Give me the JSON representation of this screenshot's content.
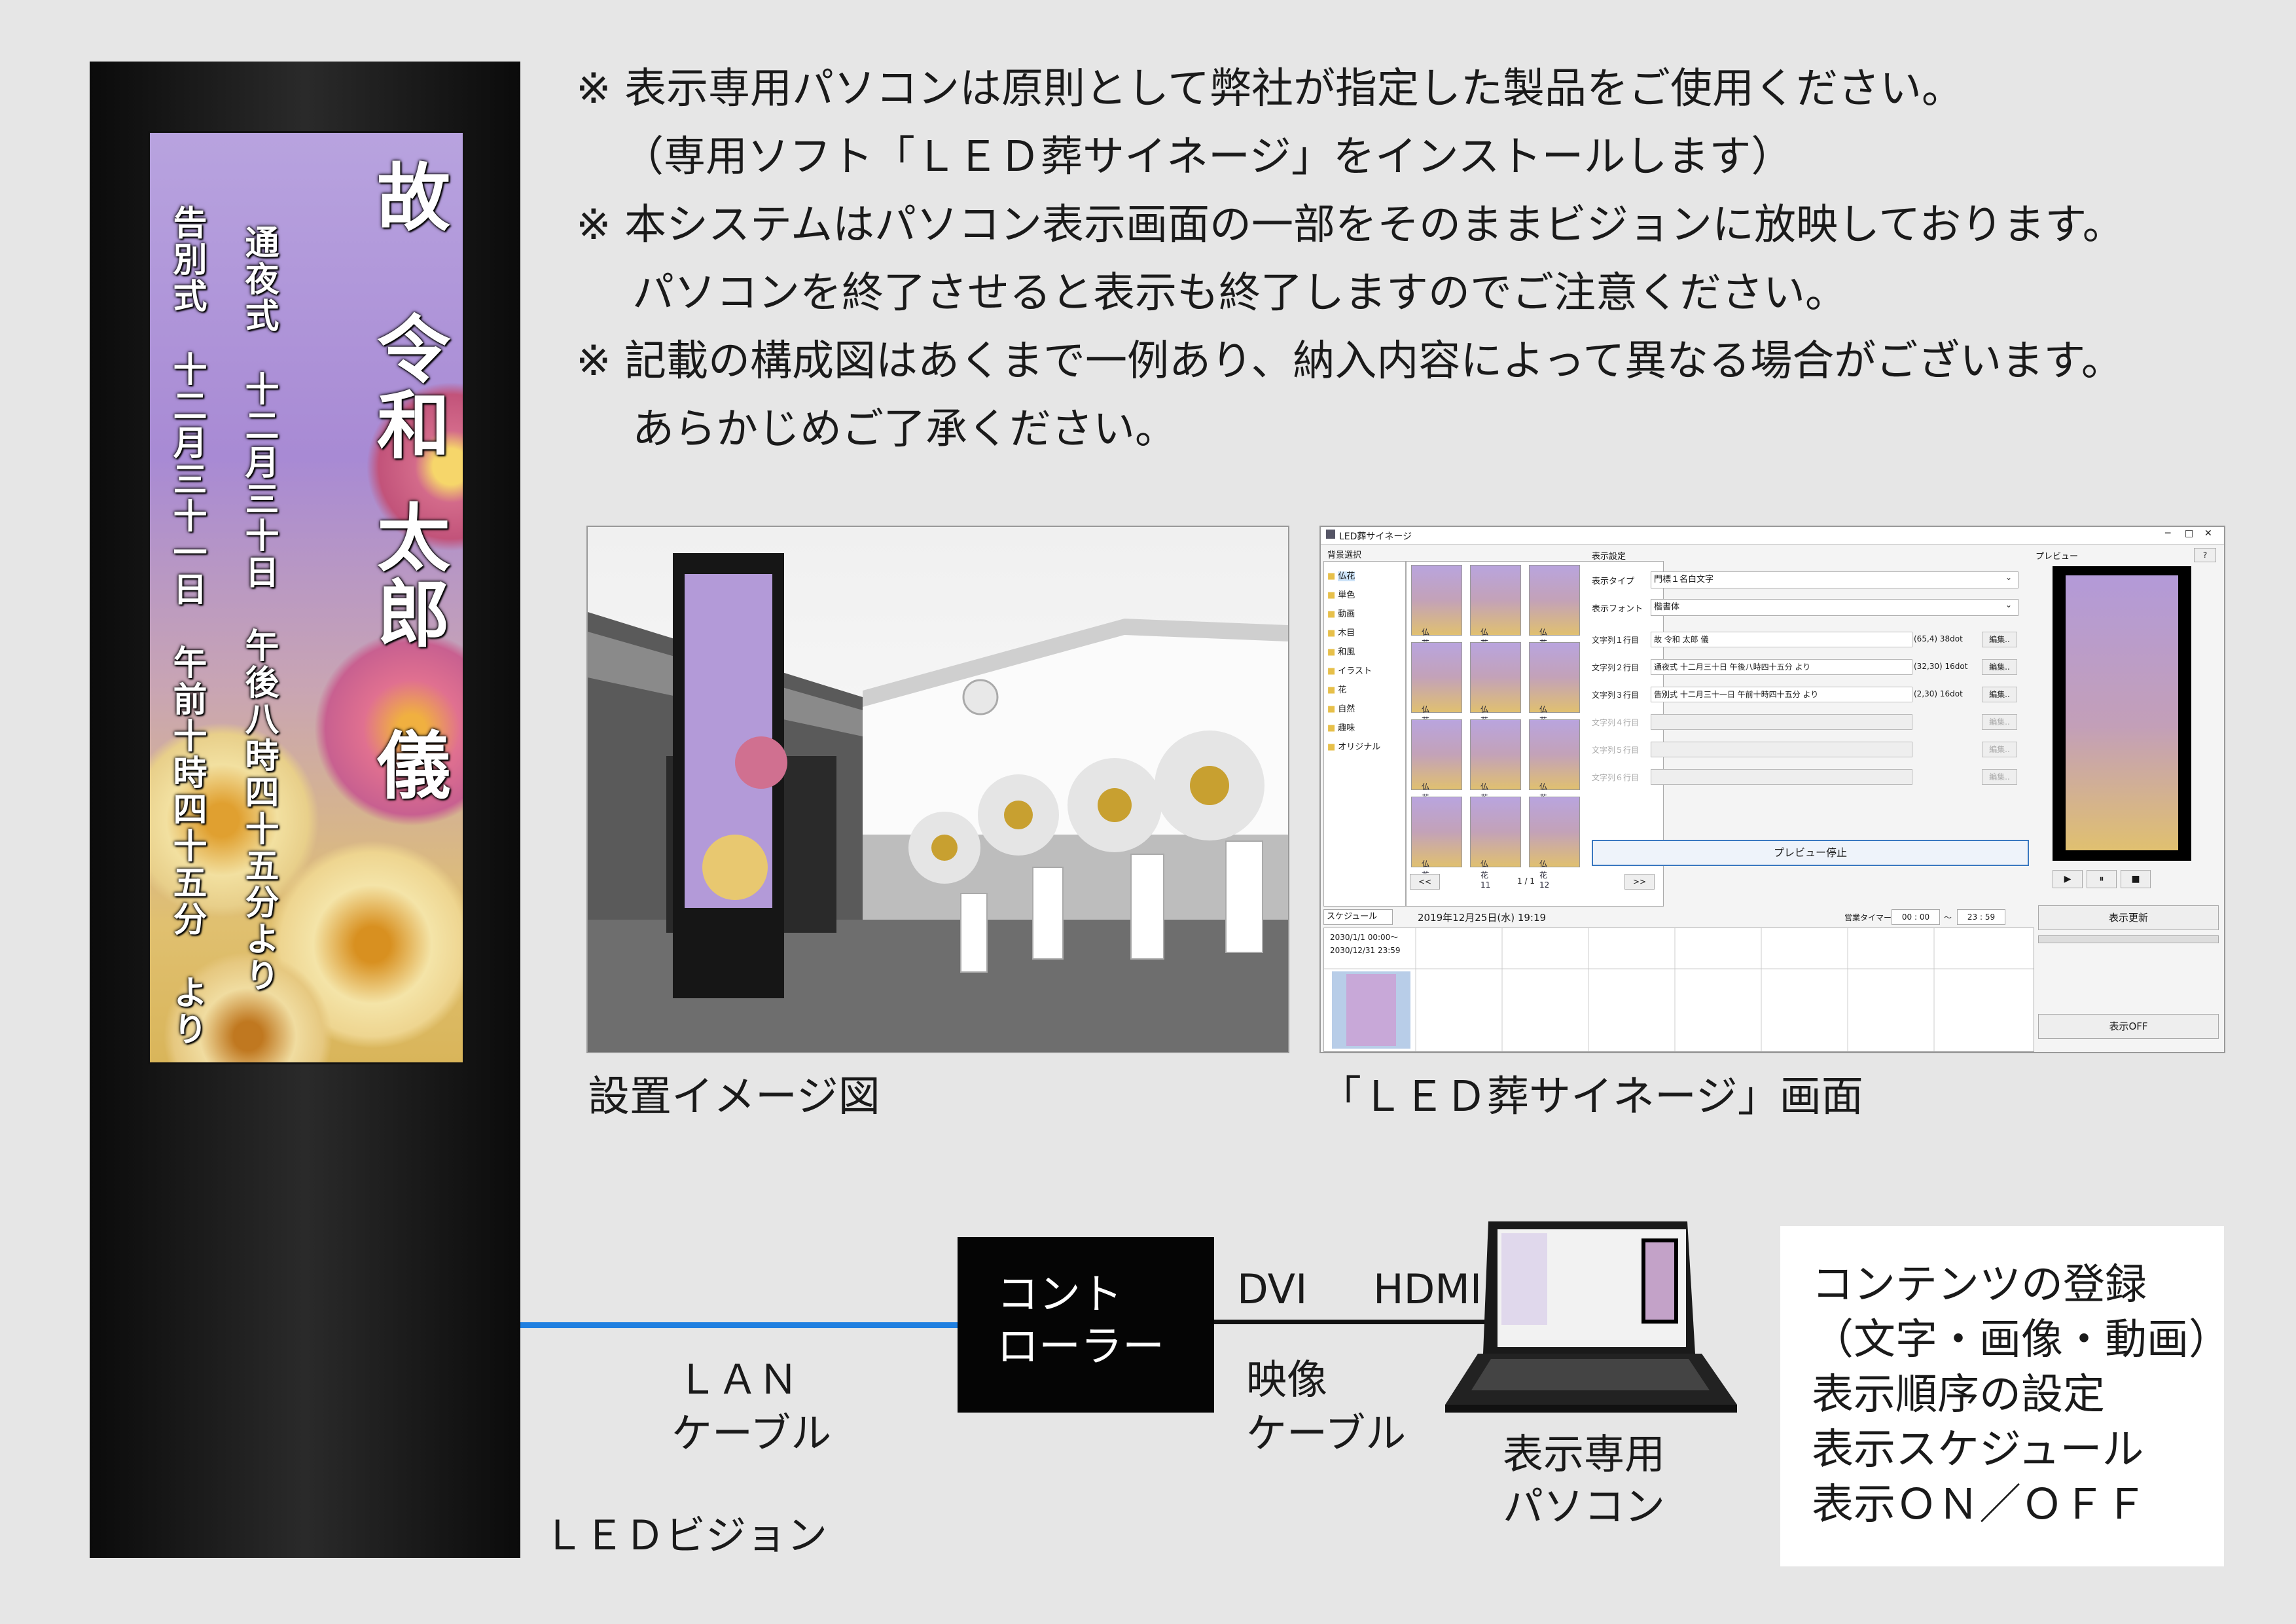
{
  "sign": {
    "main_col1": "故　令和",
    "main_col2": "太郎　儀",
    "line_wake": "通夜式　十二月三十日　午後八時四十五分より",
    "line_funeral": "告別式　十二月三十一日　午前十時四十五分　より"
  },
  "notes": [
    "※ 表示専用パソコンは原則として弊社が指定した製品をご使用ください。",
    "（専用ソフト「ＬＥＤ葬サイネージ」をインストールします）",
    "※ 本システムはパソコン表示画面の一部をそのままビジョンに放映しております。",
    "パソコンを終了させると表示も終了しますのでご注意ください。",
    "※ 記載の構成図はあくまで一例あり、納入内容によって異なる場合がございます。",
    "あらかじめご了承ください。"
  ],
  "captions": {
    "photo": "設置イメージ図",
    "app": "「ＬＥＤ葬サイネージ」画面"
  },
  "app": {
    "title": "LED葬サイネージ",
    "bg_panel_title": "背景選択",
    "categories": [
      "仏花",
      "単色",
      "動画",
      "木目",
      "和風",
      "イラスト",
      "花",
      "自然",
      "趣味",
      "オリジナル"
    ],
    "thumbs": [
      "仏花01",
      "仏花02",
      "仏花03",
      "仏花04",
      "仏花05",
      "仏花06",
      "仏花07",
      "仏花08",
      "仏花09",
      "仏花10",
      "仏花11",
      "仏花12"
    ],
    "pager": {
      "prev": "<<",
      "page": "1 / 1",
      "next": ">>"
    },
    "settings_title": "表示設定",
    "type_label": "表示タイプ",
    "type_value": "門標１名白文字",
    "font_label": "表示フォント",
    "font_value": "楷書体",
    "rows": [
      {
        "label": "文字列１行目",
        "value": "故 令和 太郎 儀",
        "info": "(65,4) 38dot",
        "btn": "編集.."
      },
      {
        "label": "文字列２行目",
        "value": "通夜式 十二月三十日 午後八時四十五分 より",
        "info": "(32,30) 16dot",
        "btn": "編集.."
      },
      {
        "label": "文字列３行目",
        "value": "告別式 十二月三十一日 午前十時四十五分 より",
        "info": "(2,30) 16dot",
        "btn": "編集.."
      },
      {
        "label": "文字列４行目",
        "value": "",
        "info": "",
        "btn": "編集.."
      },
      {
        "label": "文字列５行目",
        "value": "",
        "info": "",
        "btn": "編集.."
      },
      {
        "label": "文字列６行目",
        "value": "",
        "info": "",
        "btn": "編集.."
      }
    ],
    "preview_stop": "プレビュー停止",
    "preview_title": "プレビュー",
    "help": "?",
    "schedule_tab": "スケジュール",
    "schedule_date": "2019年12月25日(水) 19:19",
    "timer_label": "営業タイマー",
    "timer_from": "00 : 00",
    "timer_sep": "〜",
    "timer_to": "23 : 59",
    "sched_from": "2030/1/1 00:00〜",
    "sched_to": "2030/12/31 23:59",
    "btn_update": "表示更新",
    "btn_off": "表示OFF"
  },
  "diagram": {
    "controller": "コント\nローラー",
    "dvi": "DVI",
    "hdmi": "HDMI",
    "lan_1": "ＬＡＮ",
    "lan_2": "ケーブル",
    "video_1": "映像",
    "video_2": "ケーブル",
    "pc_1": "表示専用",
    "pc_2": "パソコン",
    "led": "ＬＥＤビジョン",
    "info": [
      "コンテンツの登録",
      "（文字・画像・動画）",
      "表示順序の設定",
      "表示スケジュール",
      "表示ＯＮ／ＯＦＦ"
    ]
  }
}
